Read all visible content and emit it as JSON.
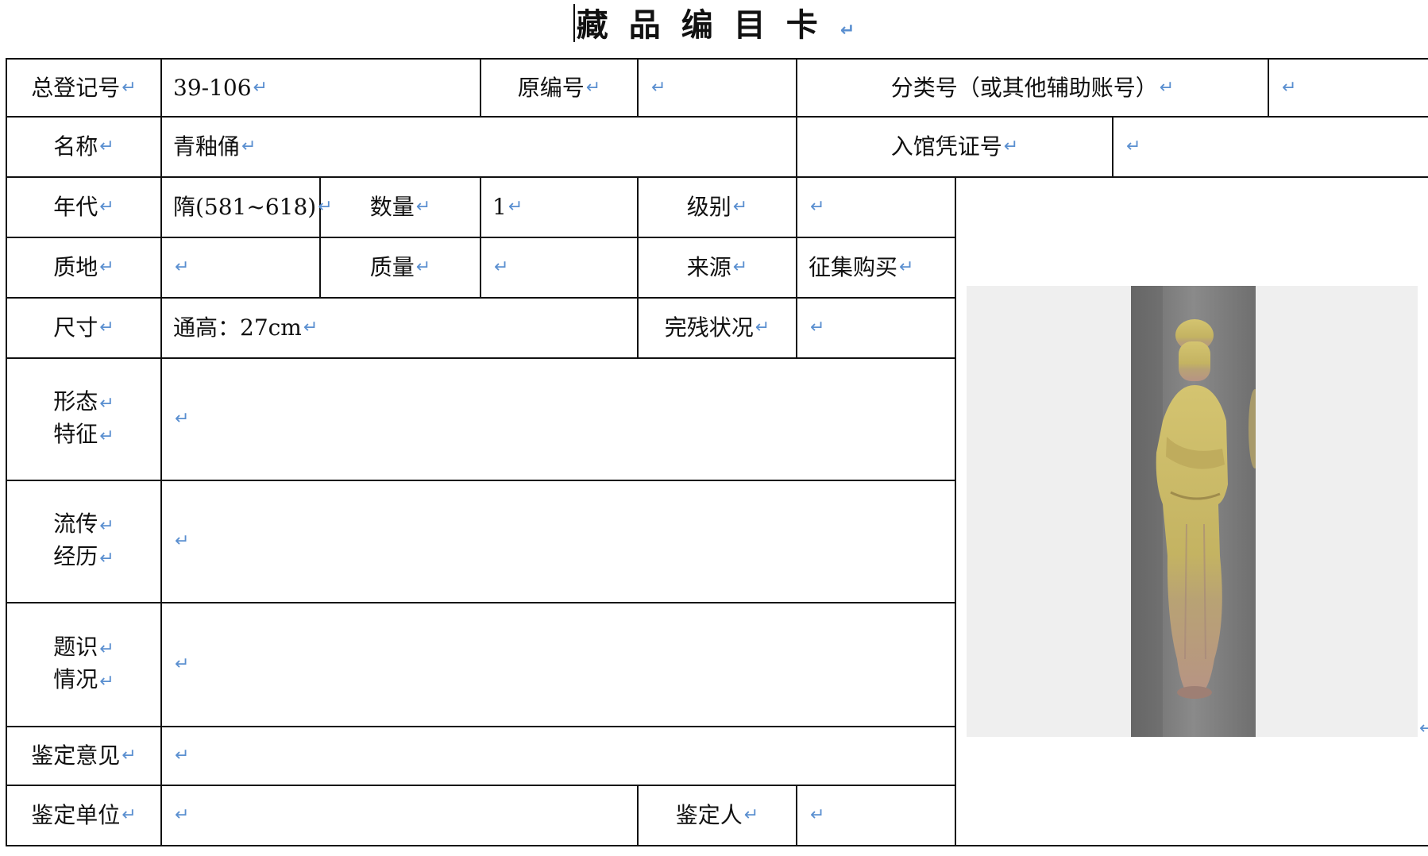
{
  "title": "藏品编目卡",
  "return_mark": "↵",
  "rows": {
    "r1": {
      "reg_no_label": "总登记号",
      "reg_no_value": "39-106",
      "orig_no_label": "原编号",
      "orig_no_value": "",
      "class_no_label": "分类号（或其他辅助账号）",
      "class_no_value": ""
    },
    "r2": {
      "name_label": "名称",
      "name_value": "青釉俑",
      "voucher_label": "入馆凭证号",
      "voucher_value": ""
    },
    "r3": {
      "era_label": "年代",
      "era_value": "隋(581~618)",
      "qty_label": "数量",
      "qty_value": "1",
      "grade_label": "级别",
      "grade_value": ""
    },
    "r4": {
      "material_label": "质地",
      "material_value": "",
      "mass_label": "质量",
      "mass_value": "",
      "source_label": "来源",
      "source_value": "征集购买"
    },
    "r5": {
      "size_label": "尺寸",
      "size_value": "通高：27cm",
      "condition_label": "完残状况",
      "condition_value": ""
    },
    "r6": {
      "form_label_1": "形态",
      "form_label_2": "特征",
      "form_value": ""
    },
    "r7": {
      "history_label_1": "流传",
      "history_label_2": "经历",
      "history_value": ""
    },
    "r8": {
      "inscr_label_1": "题识",
      "inscr_label_2": "情况",
      "inscr_value": ""
    },
    "r9": {
      "opinion_label": "鉴定意见",
      "opinion_value": ""
    },
    "r10": {
      "unit_label": "鉴定单位",
      "unit_value": "",
      "appraiser_label": "鉴定人",
      "appraiser_value": ""
    }
  },
  "colors": {
    "line": "#111111",
    "mark": "#5a8fd0",
    "photo_bg": "#efefef",
    "glaze": "#c9b75a"
  }
}
